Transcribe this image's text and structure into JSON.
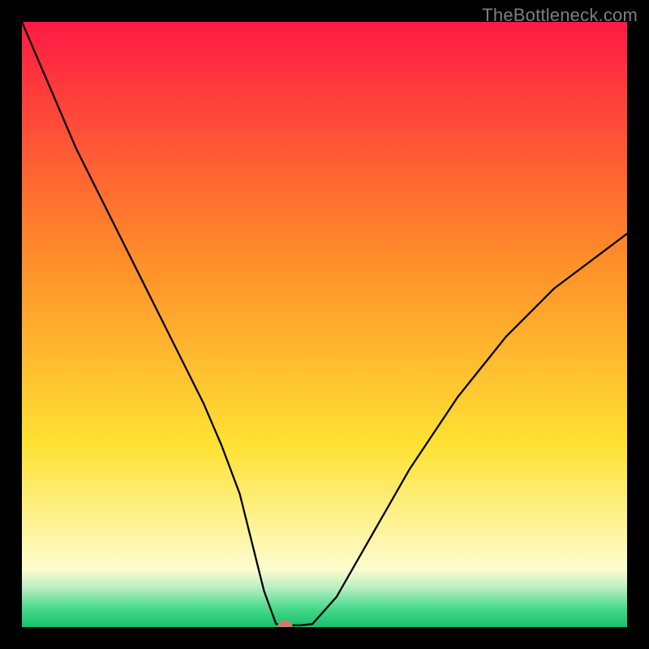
{
  "watermark": "TheBottleneck.com",
  "colors": {
    "frame": "#000000",
    "watermark": "#7f7f7f",
    "curve": "#000000",
    "marker_fill": "#d17a6b",
    "marker_stroke": "#6faf6f",
    "gradient_top": "#ff1a44",
    "gradient_mid1": "#ff8a2a",
    "gradient_mid2": "#ffe233",
    "gradient_pale": "#fdfccf",
    "gradient_green1": "#b9eec2",
    "gradient_green2": "#45d98a",
    "gradient_bottom": "#17c06a"
  },
  "chart_data": {
    "type": "line",
    "title": "",
    "xlabel": "",
    "ylabel": "",
    "xlim": [
      0,
      100
    ],
    "ylim": [
      0,
      100
    ],
    "grid": false,
    "legend": false,
    "series": [
      {
        "name": "bottleneck-curve",
        "x": [
          0,
          3,
          6,
          9,
          12,
          15,
          18,
          21,
          24,
          27,
          30,
          33,
          36,
          38,
          40,
          42,
          44,
          46,
          48,
          52,
          56,
          60,
          64,
          68,
          72,
          76,
          80,
          84,
          88,
          92,
          96,
          100
        ],
        "y": [
          100,
          93,
          86,
          79,
          73,
          67,
          61,
          55,
          49,
          43,
          37,
          30,
          22,
          14,
          6,
          0.5,
          0.3,
          0.3,
          0.5,
          5,
          12,
          19,
          26,
          32,
          38,
          43,
          48,
          52,
          56,
          59,
          62,
          65
        ]
      }
    ],
    "optimal_marker": {
      "x": 43.5,
      "y": 0.3
    },
    "gradient_stops": [
      {
        "pos": 0,
        "color": "#ff1a44"
      },
      {
        "pos": 38,
        "color": "#ff8a2a"
      },
      {
        "pos": 70,
        "color": "#ffe233"
      },
      {
        "pos": 90.5,
        "color": "#fdfccf"
      },
      {
        "pos": 93.5,
        "color": "#b9eec2"
      },
      {
        "pos": 97,
        "color": "#45d98a"
      },
      {
        "pos": 100,
        "color": "#17c06a"
      }
    ]
  }
}
